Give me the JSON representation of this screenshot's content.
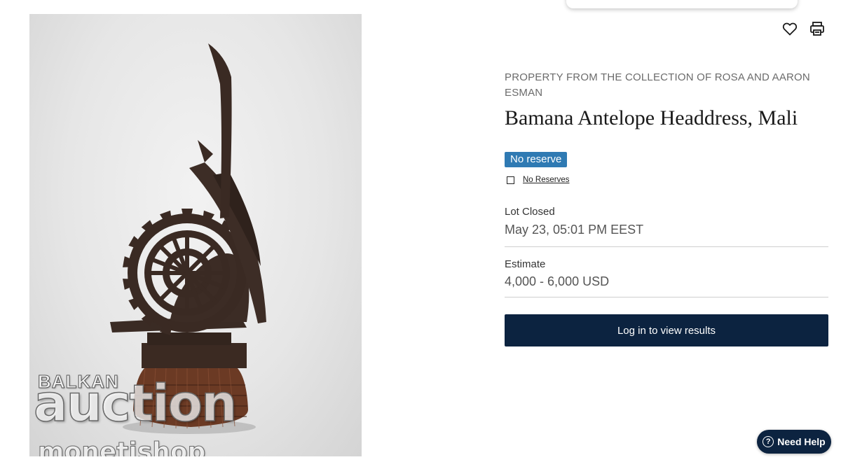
{
  "lot": {
    "provenance": "PROPERTY FROM THE COLLECTION OF ROSA AND AARON ESMAN",
    "title": "Bamana Antelope Headdress, Mali",
    "badge": "No reserve",
    "filter_label": "No Reserves",
    "status_label": "Lot Closed",
    "status_value": "May 23, 05:01 PM EEST",
    "estimate_label": "Estimate",
    "estimate_value": "4,000 - 6,000 USD"
  },
  "actions": {
    "favorite_icon": "heart-icon",
    "print_icon": "printer-icon",
    "login_label": "Log in to view results",
    "help_label": "Need Help",
    "help_icon": "?"
  },
  "watermark": {
    "line1": "BALKAN",
    "line2": "auction",
    "line3": "monetishop"
  },
  "colors": {
    "badge": "#2f7ab3",
    "primary_button": "#0c2340",
    "divider": "#cfcfcf"
  }
}
